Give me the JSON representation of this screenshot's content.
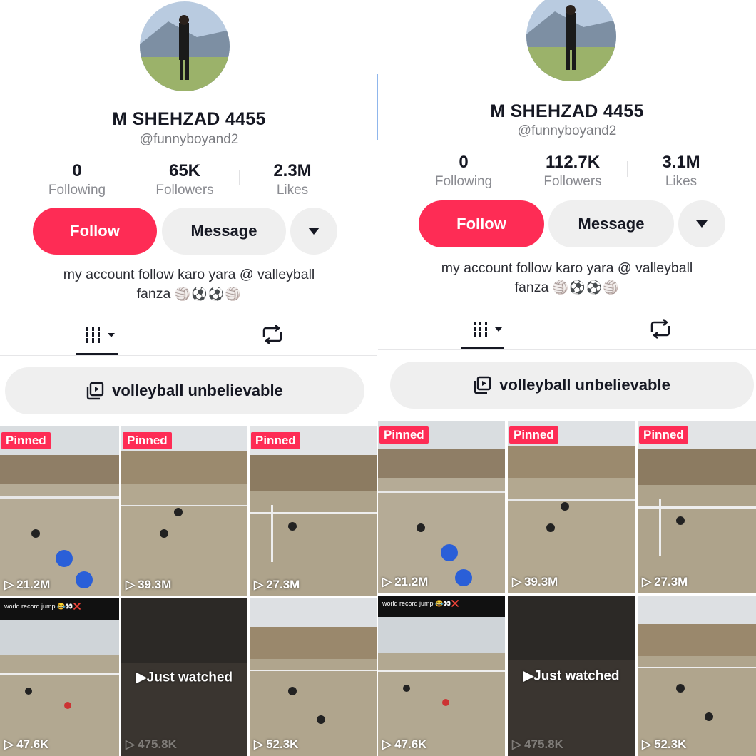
{
  "left": {
    "name": "M SHEHZAD 4455",
    "handle": "@funnyboyand2",
    "stats": [
      {
        "num": "0",
        "label": "Following"
      },
      {
        "num": "65K",
        "label": "Followers"
      },
      {
        "num": "2.3M",
        "label": "Likes"
      }
    ],
    "follow_label": "Follow",
    "message_label": "Message",
    "bio_line1": "my account follow karo yara @ valleyball",
    "bio_line2": "fanza",
    "bio_emoji": "🏐⚽⚽🏐",
    "playlist_label": "volleyball unbelievable",
    "videos": [
      {
        "views": "21.2M",
        "pinned": "Pinned"
      },
      {
        "views": "39.3M",
        "pinned": "Pinned"
      },
      {
        "views": "27.3M",
        "pinned": "Pinned"
      },
      {
        "views": "47.6K",
        "caption": "world record jump 😂👀❌"
      },
      {
        "views": "475.8K",
        "overlay": "Just watched"
      },
      {
        "views": "52.3K"
      }
    ]
  },
  "right": {
    "name": "M SHEHZAD 4455",
    "handle": "@funnyboyand2",
    "stats": [
      {
        "num": "0",
        "label": "Following"
      },
      {
        "num": "112.7K",
        "label": "Followers"
      },
      {
        "num": "3.1M",
        "label": "Likes"
      }
    ],
    "follow_label": "Follow",
    "message_label": "Message",
    "bio_line1": "my account follow karo yara @ valleyball",
    "bio_line2": "fanza",
    "bio_emoji": "🏐⚽⚽🏐",
    "playlist_label": "volleyball unbelievable",
    "videos": [
      {
        "views": "21.2M",
        "pinned": "Pinned"
      },
      {
        "views": "39.3M",
        "pinned": "Pinned"
      },
      {
        "views": "27.3M",
        "pinned": "Pinned"
      },
      {
        "views": "47.6K",
        "caption": "world record jump 😂👀❌"
      },
      {
        "views": "475.8K",
        "overlay": "Just watched"
      },
      {
        "views": "52.3K"
      }
    ]
  },
  "colors": {
    "accent": "#fe2c55",
    "button_gray": "#efefef",
    "text": "#161823",
    "muted": "#8a8b91"
  }
}
